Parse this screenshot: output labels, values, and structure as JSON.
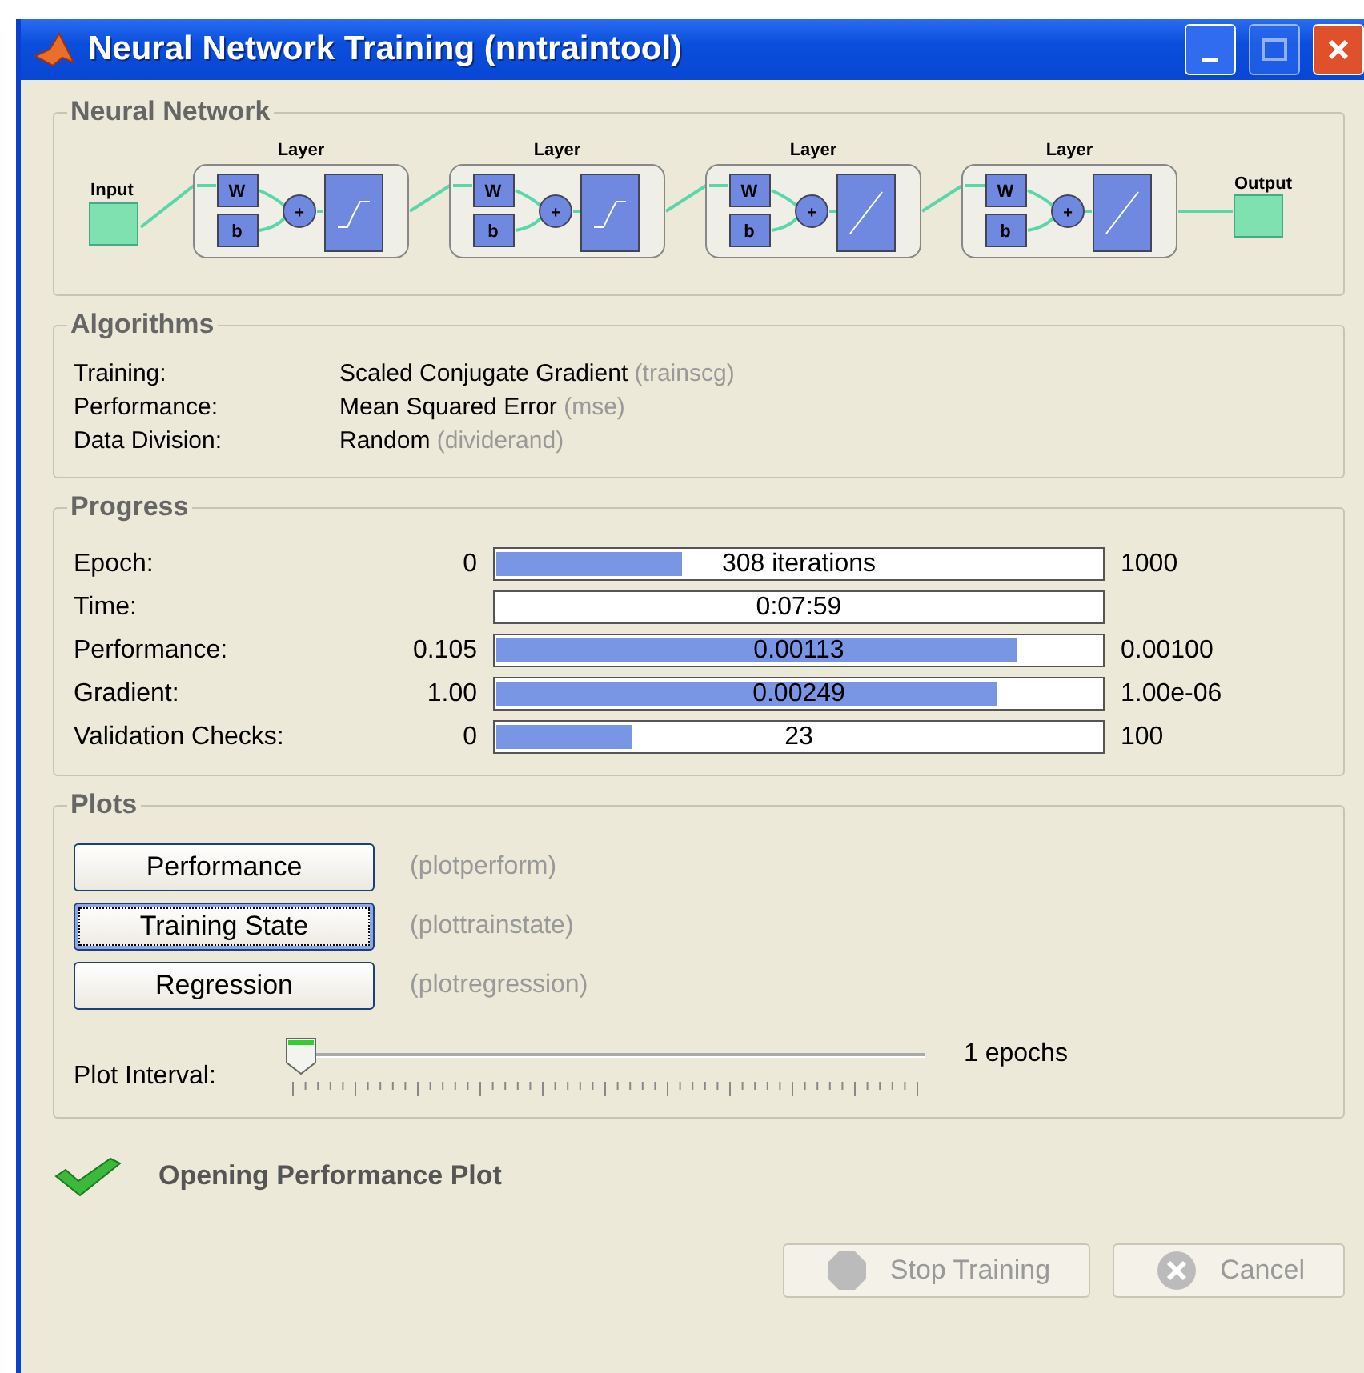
{
  "window": {
    "title": "Neural Network Training (nntraintool)",
    "maximize_disabled": true
  },
  "network": {
    "legend": "Neural Network",
    "input_label": "Input",
    "output_label": "Output",
    "layers": [
      {
        "label": "Layer",
        "weight": "W",
        "bias": "b",
        "sum": "+",
        "kind": "sigmoid"
      },
      {
        "label": "Layer",
        "weight": "W",
        "bias": "b",
        "sum": "+",
        "kind": "sigmoid"
      },
      {
        "label": "Layer",
        "weight": "W",
        "bias": "b",
        "sum": "+",
        "kind": "linear"
      },
      {
        "label": "Layer",
        "weight": "W",
        "bias": "b",
        "sum": "+",
        "kind": "linear"
      }
    ]
  },
  "algorithms": {
    "legend": "Algorithms",
    "rows": [
      {
        "label": "Training:",
        "value": "Scaled Conjugate Gradient",
        "function": "(trainscg)"
      },
      {
        "label": "Performance:",
        "value": "Mean Squared Error",
        "function": "(mse)"
      },
      {
        "label": "Data Division:",
        "value": "Random",
        "function": "(dividerand)"
      }
    ]
  },
  "progress": {
    "legend": "Progress",
    "rows": [
      {
        "label": "Epoch:",
        "start": "0",
        "reading": "308 iterations",
        "level": 0.31,
        "end": "1000"
      },
      {
        "label": "Time:",
        "reading": "0:07:59",
        "level": 0
      },
      {
        "label": "Performance:",
        "start": "0.105",
        "reading": "0.00113",
        "level": 0.86,
        "end": "0.00100"
      },
      {
        "label": "Gradient:",
        "start": "1.00",
        "reading": "0.00249",
        "level": 0.83,
        "end": "1.00e-06"
      },
      {
        "label": "Validation Checks:",
        "start": "0",
        "reading": "23",
        "level": 0.23,
        "end": "100"
      }
    ]
  },
  "plots": {
    "legend": "Plots",
    "buttons": [
      {
        "label": "Performance",
        "function": "(plotperform)",
        "focused": false
      },
      {
        "label": "Training State",
        "function": "(plottrainstate)",
        "focused": true
      },
      {
        "label": "Regression",
        "function": "(plotregression)",
        "focused": false
      }
    ],
    "interval": {
      "label": "Plot Interval:",
      "level": 0,
      "reading": "1 epochs"
    }
  },
  "status": {
    "text": "Opening Performance Plot"
  },
  "buttons": [
    {
      "label": "Stop Training",
      "kind": "stop",
      "disabled": true
    },
    {
      "label": "Cancel",
      "kind": "cancel",
      "disabled": true
    }
  ]
}
